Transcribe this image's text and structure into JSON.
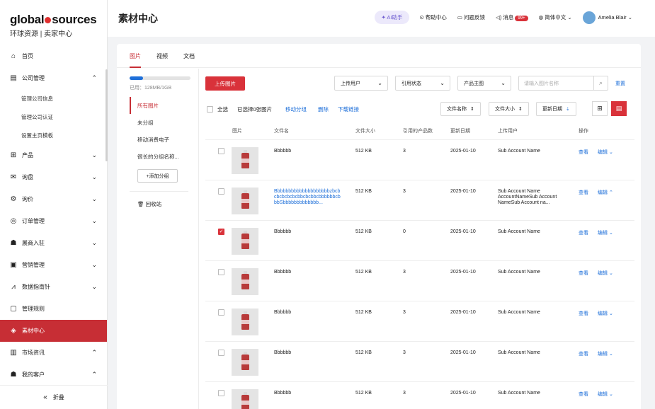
{
  "brand": {
    "name_part1": "global",
    "name_part2": "sources",
    "subtitle": "环球资源 | 卖家中心"
  },
  "sidebar": {
    "items": [
      {
        "label": "首页",
        "icon": "home-icon",
        "glyph": "⌂",
        "chevron": ""
      },
      {
        "label": "公司管理",
        "icon": "company-icon",
        "glyph": "▤",
        "chevron": "⌃"
      },
      {
        "label": "产品",
        "icon": "grid-icon",
        "glyph": "⊞",
        "chevron": "⌄"
      },
      {
        "label": "询盘",
        "icon": "mail-icon",
        "glyph": "✉",
        "chevron": "⌄"
      },
      {
        "label": "询价",
        "icon": "quote-icon",
        "glyph": "⚙",
        "chevron": "⌄"
      },
      {
        "label": "订单管理",
        "icon": "order-icon",
        "glyph": "◎",
        "chevron": "⌄"
      },
      {
        "label": "展商入驻",
        "icon": "exhibitor-icon",
        "glyph": "☗",
        "chevron": "⌄"
      },
      {
        "label": "营销管理",
        "icon": "marketing-icon",
        "glyph": "▣",
        "chevron": "⌄"
      },
      {
        "label": "数据指南针",
        "icon": "chart-icon",
        "glyph": "⩘",
        "chevron": "⌄"
      },
      {
        "label": "管理规则",
        "icon": "rules-icon",
        "glyph": "▢",
        "chevron": ""
      },
      {
        "label": "素材中心",
        "icon": "material-icon",
        "glyph": "◈",
        "chevron": ""
      },
      {
        "label": "市场资讯",
        "icon": "news-icon",
        "glyph": "▥",
        "chevron": "⌃"
      },
      {
        "label": "我的客户",
        "icon": "customer-icon",
        "glyph": "☗",
        "chevron": "⌃"
      }
    ],
    "company_sub": [
      "管理公司信息",
      "管理公司认证",
      "设置主页模板"
    ],
    "collapse_label": "折叠",
    "collapse_glyph": "«"
  },
  "header": {
    "title": "素材中心",
    "ai_label": "AI助手",
    "help_label": "帮助中心",
    "feedback_label": "问题反馈",
    "messages_label": "消息",
    "messages_badge": "99+",
    "language_label": "简体中文",
    "user_name": "Amelia Blair"
  },
  "tabs": [
    "图片",
    "视频",
    "文档"
  ],
  "folders": {
    "usage_text": "已用：128MB/1GB",
    "usage_fraction": 0.22,
    "items": [
      "所有图片",
      "未分组",
      "移动消费电子",
      "很长的分组名称..."
    ],
    "add_label": "+添加分组",
    "recycle_label": "回收站"
  },
  "toolbar": {
    "upload_label": "上传图片",
    "uploader_select": "上传用户",
    "reference_select": "引用状态",
    "product_select": "产品主图",
    "search_placeholder": "请输入图片名称",
    "reset_label": "重置"
  },
  "bulk": {
    "select_all": "全选",
    "selected_text": "已选择0张图片",
    "move_label": "移动分组",
    "delete_label": "删除",
    "download_label": "下载链接",
    "sort_name": "文件名称",
    "sort_size": "文件大小",
    "sort_date": "更新日期"
  },
  "table": {
    "headers": [
      "图片",
      "文件名",
      "文件大小",
      "引用的产品数",
      "更新日期",
      "上传用户",
      "操作"
    ],
    "rows": [
      {
        "name": "Bbbbbb",
        "link": false,
        "size": "512 KB",
        "refs": "3",
        "date": "2025-01-10",
        "uploader": "Sub Account Name",
        "view": "查看",
        "edit": "编辑 ⌄",
        "checked": false
      },
      {
        "name": "BbbbbbbbbbbbbbbbbbbbzbcbcbcbcbcbcbbcbcbbcbbbbbbcbbbSbbbbbbbbbbbbb...",
        "link": true,
        "size": "512 KB",
        "refs": "3",
        "date": "2025-01-10",
        "uploader": "Sub Account Name AccountNameSub Account NameSub Account na...",
        "view": "查看",
        "edit": "编辑 ⌃",
        "checked": false
      },
      {
        "name": "Bbbbbb",
        "link": false,
        "size": "512 KB",
        "refs": "0",
        "date": "2025-01-10",
        "uploader": "Sub Account Name",
        "view": "查看",
        "edit": "编辑 ⌄",
        "checked": true
      },
      {
        "name": "Bbbbbb",
        "link": false,
        "size": "512 KB",
        "refs": "3",
        "date": "2025-01-10",
        "uploader": "Sub Account Name",
        "view": "查看",
        "edit": "编辑 ⌄",
        "checked": false
      },
      {
        "name": "Bbbbbb",
        "link": false,
        "size": "512 KB",
        "refs": "3",
        "date": "2025-01-10",
        "uploader": "Sub Account Name",
        "view": "查看",
        "edit": "编辑 ⌄",
        "checked": false
      },
      {
        "name": "Bbbbbb",
        "link": false,
        "size": "512 KB",
        "refs": "3",
        "date": "2025-01-10",
        "uploader": "Sub Account Name",
        "view": "查看",
        "edit": "编辑 ⌄",
        "checked": false
      },
      {
        "name": "Bbbbbb",
        "link": false,
        "size": "512 KB",
        "refs": "3",
        "date": "2025-01-10",
        "uploader": "Sub Account Name",
        "view": "查看",
        "edit": "编辑 ⌄",
        "checked": false
      }
    ]
  },
  "colors": {
    "accent": "#d9323a",
    "link": "#1e6fd9"
  }
}
